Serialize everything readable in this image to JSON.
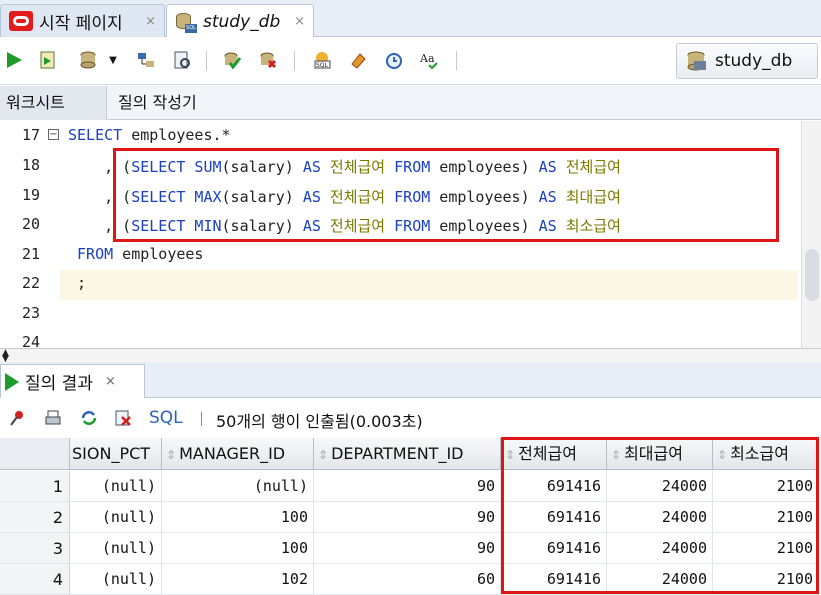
{
  "tabs": [
    {
      "label": "시작 페이지",
      "close": "×"
    },
    {
      "label": "study_db",
      "close": "×"
    }
  ],
  "toolbar": {
    "connection": "study_db"
  },
  "subtabs": [
    "워크시트",
    "질의 작성기"
  ],
  "editor": {
    "line_numbers": [
      "17",
      "18",
      "19",
      "20",
      "21",
      "22",
      "23",
      "24"
    ],
    "lines": [
      {
        "parts": [
          {
            "t": "SELECT",
            "c": "kw"
          },
          {
            "t": " employees.*",
            "c": "id"
          }
        ]
      },
      {
        "parts": [
          {
            "t": "    , (",
            "c": "id"
          },
          {
            "t": "SELECT SUM",
            "c": "kw"
          },
          {
            "t": "(salary) ",
            "c": "id"
          },
          {
            "t": "AS",
            "c": "kw"
          },
          {
            "t": " 전체급여 ",
            "c": "str"
          },
          {
            "t": "FROM",
            "c": "kw"
          },
          {
            "t": " employees) ",
            "c": "id"
          },
          {
            "t": "AS",
            "c": "kw"
          },
          {
            "t": " 전체급여",
            "c": "str"
          }
        ]
      },
      {
        "parts": [
          {
            "t": "    , (",
            "c": "id"
          },
          {
            "t": "SELECT MAX",
            "c": "kw"
          },
          {
            "t": "(salary) ",
            "c": "id"
          },
          {
            "t": "AS",
            "c": "kw"
          },
          {
            "t": " 전체급여 ",
            "c": "str"
          },
          {
            "t": "FROM",
            "c": "kw"
          },
          {
            "t": " employees) ",
            "c": "id"
          },
          {
            "t": "AS",
            "c": "kw"
          },
          {
            "t": " 최대급여",
            "c": "str"
          }
        ]
      },
      {
        "parts": [
          {
            "t": "    , (",
            "c": "id"
          },
          {
            "t": "SELECT MIN",
            "c": "kw"
          },
          {
            "t": "(salary) ",
            "c": "id"
          },
          {
            "t": "AS",
            "c": "kw"
          },
          {
            "t": " 전체급여 ",
            "c": "str"
          },
          {
            "t": "FROM",
            "c": "kw"
          },
          {
            "t": " employees) ",
            "c": "id"
          },
          {
            "t": "AS",
            "c": "kw"
          },
          {
            "t": " 최소급여",
            "c": "str"
          }
        ]
      },
      {
        "parts": [
          {
            "t": " FROM",
            "c": "kw"
          },
          {
            "t": " employees",
            "c": "id"
          }
        ]
      },
      {
        "parts": [
          {
            "t": " ;",
            "c": "id"
          }
        ]
      },
      {
        "parts": []
      },
      {
        "parts": []
      }
    ]
  },
  "results": {
    "tab_label": "질의 결과",
    "tab_close": "×",
    "sql_link": "SQL",
    "status": "50개의 행이 인출됨(0.003초)",
    "columns": [
      "SION_PCT",
      "MANAGER_ID",
      "DEPARTMENT_ID",
      "전체급여",
      "최대급여",
      "최소급여"
    ],
    "rows": [
      {
        "n": "1",
        "cells": [
          "(null)",
          "(null)",
          "90",
          "691416",
          "24000",
          "2100"
        ]
      },
      {
        "n": "2",
        "cells": [
          "(null)",
          "100",
          "90",
          "691416",
          "24000",
          "2100"
        ]
      },
      {
        "n": "3",
        "cells": [
          "(null)",
          "100",
          "90",
          "691416",
          "24000",
          "2100"
        ]
      },
      {
        "n": "4",
        "cells": [
          "(null)",
          "102",
          "60",
          "691416",
          "24000",
          "2100"
        ]
      }
    ]
  },
  "colors": {
    "keyword": "#1a3fc2",
    "alias": "#7a7a00",
    "highlight_box": "#e01616",
    "run_green": "#1c9d2b"
  }
}
